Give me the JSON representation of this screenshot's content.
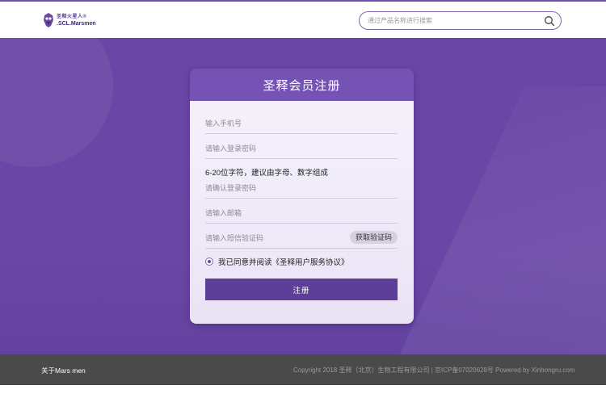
{
  "header": {
    "logo": {
      "cn": "圣释火星人®",
      "en": ".SCL.Marsmen"
    },
    "search": {
      "placeholder": "通过产品名称进行搜索",
      "icon": "search-icon"
    }
  },
  "form": {
    "title": "圣释会员注册",
    "phone_placeholder": "输入手机号",
    "password_placeholder": "请输入登录密码",
    "password_hint": "6-20位字符，建议由字母、数字组成",
    "confirm_placeholder": "请确认登录密码",
    "email_placeholder": "请输入邮箱",
    "sms_placeholder": "请输入短信验证码",
    "get_code_label": "获取验证码",
    "agree_label": "我已同意并阅读《圣释用户服务协议》",
    "submit_label": "注册"
  },
  "footer": {
    "about": "关于Mars men",
    "copyright": "Copyright 2018 圣释（北京）生物工程有限公司 |   京ICP备07020628号     Powered by Xinhongru.com"
  },
  "colors": {
    "brand_purple": "#6a47a6",
    "card_header": "#7553b5",
    "button": "#5d3f98",
    "footer_bg": "#4a4a4a"
  }
}
